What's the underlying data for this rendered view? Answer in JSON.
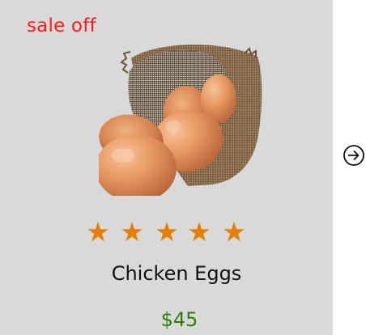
{
  "card": {
    "badge": "sale off",
    "product_name": "Chicken Eggs",
    "price": "$45",
    "rating": {
      "value": 5,
      "max": 5,
      "star_glyph": "★",
      "color": "#e67e00"
    },
    "image_icon": "eggs-in-burlap-sack-image"
  },
  "carousel": {
    "next_icon": "arrow-right-circle-icon"
  },
  "colors": {
    "card_background": "#d9d9d9",
    "badge": "#ff1a1a",
    "price": "#2e7d0e",
    "star": "#e67e00"
  }
}
